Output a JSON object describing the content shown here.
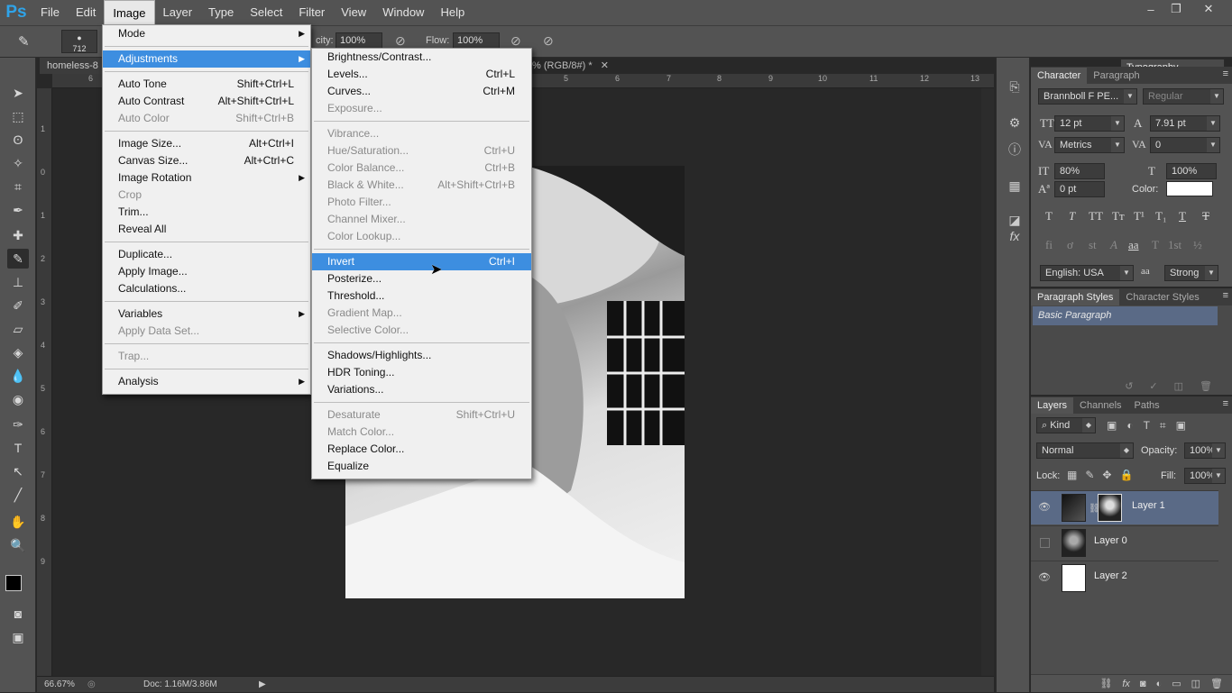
{
  "menubar": {
    "logo": "Ps",
    "items": [
      "File",
      "Edit",
      "Image",
      "Layer",
      "Type",
      "Select",
      "Filter",
      "View",
      "Window",
      "Help"
    ],
    "active": "Image"
  },
  "window_controls": [
    "–",
    "❐",
    "✕"
  ],
  "options": {
    "brush_size": "712",
    "opacity_label": "city:",
    "opacity_value": "100%",
    "flow_label": "Flow:",
    "flow_value": "100%",
    "workspace": "Typography"
  },
  "document": {
    "tab_title": "homeless-8",
    "tab_suffix": "% (RGB/8#) *",
    "zoom": "66.67%",
    "doc_info": "Doc: 1.16M/3.86M",
    "ruler_h_ticks": [
      "6",
      "5",
      "6",
      "7",
      "8",
      "9",
      "10",
      "11",
      "12",
      "13",
      "14"
    ],
    "ruler_v_ticks": [
      "1",
      "0",
      "1",
      "2",
      "3",
      "4",
      "5",
      "6",
      "7",
      "8",
      "9",
      "1",
      "1"
    ]
  },
  "image_menu": {
    "items": [
      {
        "label": "Mode",
        "shortcut": "",
        "submenu": true,
        "disabled": false
      },
      {
        "sep": true
      },
      {
        "label": "Adjustments",
        "shortcut": "",
        "submenu": true,
        "disabled": false,
        "highlight": true
      },
      {
        "sep": true
      },
      {
        "label": "Auto Tone",
        "shortcut": "Shift+Ctrl+L"
      },
      {
        "label": "Auto Contrast",
        "shortcut": "Alt+Shift+Ctrl+L"
      },
      {
        "label": "Auto Color",
        "shortcut": "Shift+Ctrl+B",
        "disabled": true
      },
      {
        "sep": true
      },
      {
        "label": "Image Size...",
        "shortcut": "Alt+Ctrl+I"
      },
      {
        "label": "Canvas Size...",
        "shortcut": "Alt+Ctrl+C"
      },
      {
        "label": "Image Rotation",
        "shortcut": "",
        "submenu": true
      },
      {
        "label": "Crop",
        "shortcut": "",
        "disabled": true
      },
      {
        "label": "Trim...",
        "shortcut": ""
      },
      {
        "label": "Reveal All",
        "shortcut": ""
      },
      {
        "sep": true
      },
      {
        "label": "Duplicate...",
        "shortcut": ""
      },
      {
        "label": "Apply Image...",
        "shortcut": ""
      },
      {
        "label": "Calculations...",
        "shortcut": ""
      },
      {
        "sep": true
      },
      {
        "label": "Variables",
        "shortcut": "",
        "submenu": true
      },
      {
        "label": "Apply Data Set...",
        "shortcut": "",
        "disabled": true
      },
      {
        "sep": true
      },
      {
        "label": "Trap...",
        "shortcut": "",
        "disabled": true
      },
      {
        "sep": true
      },
      {
        "label": "Analysis",
        "shortcut": "",
        "submenu": true
      }
    ]
  },
  "adjustments_menu": {
    "items": [
      {
        "label": "Brightness/Contrast...",
        "shortcut": ""
      },
      {
        "label": "Levels...",
        "shortcut": "Ctrl+L"
      },
      {
        "label": "Curves...",
        "shortcut": "Ctrl+M"
      },
      {
        "label": "Exposure...",
        "shortcut": "",
        "disabled": true
      },
      {
        "sep": true
      },
      {
        "label": "Vibrance...",
        "shortcut": "",
        "disabled": true
      },
      {
        "label": "Hue/Saturation...",
        "shortcut": "Ctrl+U",
        "disabled": true
      },
      {
        "label": "Color Balance...",
        "shortcut": "Ctrl+B",
        "disabled": true
      },
      {
        "label": "Black & White...",
        "shortcut": "Alt+Shift+Ctrl+B",
        "disabled": true
      },
      {
        "label": "Photo Filter...",
        "shortcut": "",
        "disabled": true
      },
      {
        "label": "Channel Mixer...",
        "shortcut": "",
        "disabled": true
      },
      {
        "label": "Color Lookup...",
        "shortcut": "",
        "disabled": true
      },
      {
        "sep": true
      },
      {
        "label": "Invert",
        "shortcut": "Ctrl+I",
        "highlight": true
      },
      {
        "label": "Posterize...",
        "shortcut": ""
      },
      {
        "label": "Threshold...",
        "shortcut": ""
      },
      {
        "label": "Gradient Map...",
        "shortcut": "",
        "disabled": true
      },
      {
        "label": "Selective Color...",
        "shortcut": "",
        "disabled": true
      },
      {
        "sep": true
      },
      {
        "label": "Shadows/Highlights...",
        "shortcut": ""
      },
      {
        "label": "HDR Toning...",
        "shortcut": ""
      },
      {
        "label": "Variations...",
        "shortcut": ""
      },
      {
        "sep": true
      },
      {
        "label": "Desaturate",
        "shortcut": "Shift+Ctrl+U",
        "disabled": true
      },
      {
        "label": "Match Color...",
        "shortcut": "",
        "disabled": true
      },
      {
        "label": "Replace Color...",
        "shortcut": ""
      },
      {
        "label": "Equalize",
        "shortcut": ""
      }
    ]
  },
  "character_panel": {
    "tabs": [
      "Character",
      "Paragraph"
    ],
    "font_family": "Brannboll F PE...",
    "font_style": "Regular",
    "size": "12 pt",
    "leading": "7.91 pt",
    "kerning": "Metrics",
    "tracking": "0",
    "vscale": "80%",
    "hscale": "100%",
    "baseline": "0 pt",
    "color_label": "Color:",
    "language": "English: USA",
    "antialias_icon": "aa",
    "antialias": "Strong"
  },
  "paragraph_styles_panel": {
    "tabs": [
      "Paragraph Styles",
      "Character Styles"
    ],
    "item": "Basic Paragraph"
  },
  "layers_panel": {
    "tabs": [
      "Layers",
      "Channels",
      "Paths"
    ],
    "filter": "Kind",
    "blend_mode": "Normal",
    "opacity_label": "Opacity:",
    "opacity": "100%",
    "lock_label": "Lock:",
    "fill_label": "Fill:",
    "fill": "100%",
    "layers": [
      {
        "name": "Layer 1",
        "visible": true,
        "selected": true
      },
      {
        "name": "Layer 0",
        "visible": false,
        "selected": false
      },
      {
        "name": "Layer 2",
        "visible": true,
        "selected": false
      }
    ]
  },
  "colors": {
    "accent": "#3d8ee0",
    "panel": "#535353",
    "selected_layer": "#5a6a86"
  }
}
